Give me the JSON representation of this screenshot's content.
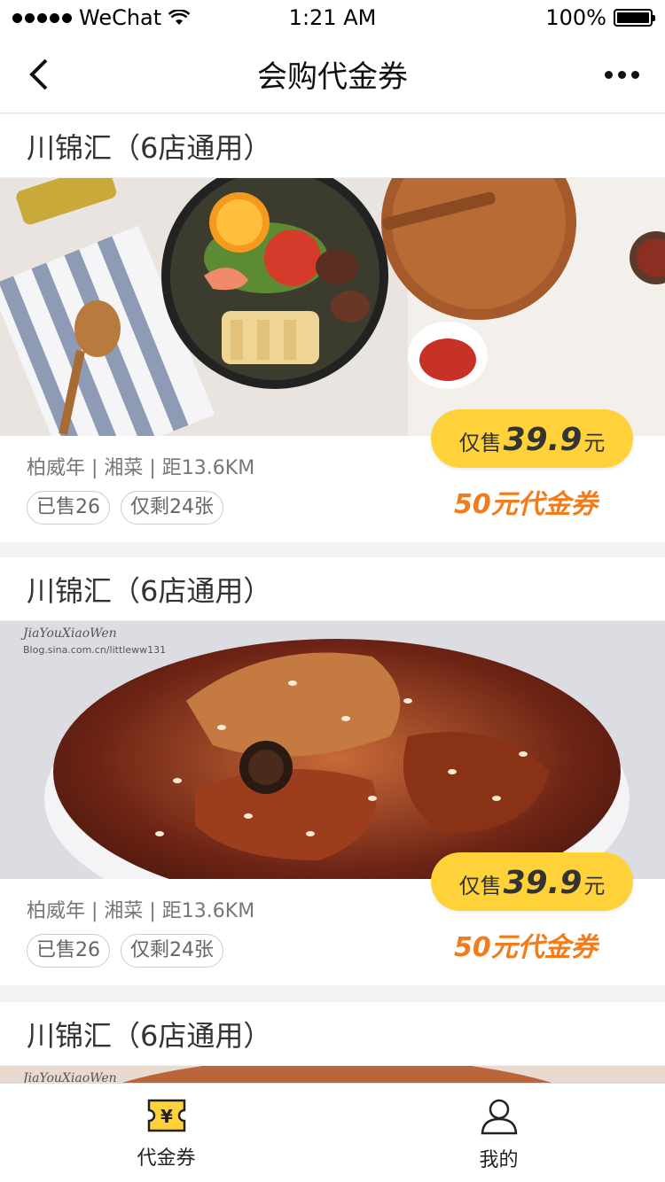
{
  "status": {
    "carrier": "WeChat",
    "time": "1:21 AM",
    "battery": "100%"
  },
  "nav": {
    "title": "会购代金券"
  },
  "cards": [
    {
      "title": "川锦汇（6店通用）",
      "meta": "柏威年 | 湘菜 | 距13.6KM",
      "tag_sold": "已售26",
      "tag_left": "仅剩24张",
      "price_pre": "仅售",
      "price": "39.9",
      "price_unit": "元",
      "voucher": "50元代金券",
      "image": "hotpot-dish-photo"
    },
    {
      "title": "川锦汇（6店通用）",
      "meta": "柏威年 | 湘菜 | 距13.6KM",
      "tag_sold": "已售26",
      "tag_left": "仅剩24张",
      "price_pre": "仅售",
      "price": "39.9",
      "price_unit": "元",
      "voucher": "50元代金券",
      "image": "braised-ribs-photo",
      "watermark_1": "JiaYouXiaoWen",
      "watermark_2": "Blog.sina.com.cn/littleww131"
    },
    {
      "title": "川锦汇（6店通用）",
      "image": "braised-ribs-photo",
      "watermark_1": "JiaYouXiaoWen"
    }
  ],
  "tabs": [
    {
      "label": "代金券",
      "icon": "voucher-icon",
      "glyph": "¥",
      "active": true
    },
    {
      "label": "我的",
      "icon": "user-icon",
      "active": false
    }
  ],
  "colors": {
    "accent_yellow": "#ffd23a",
    "voucher_orange": "#f27c1a",
    "background": "#f2f2f4"
  }
}
